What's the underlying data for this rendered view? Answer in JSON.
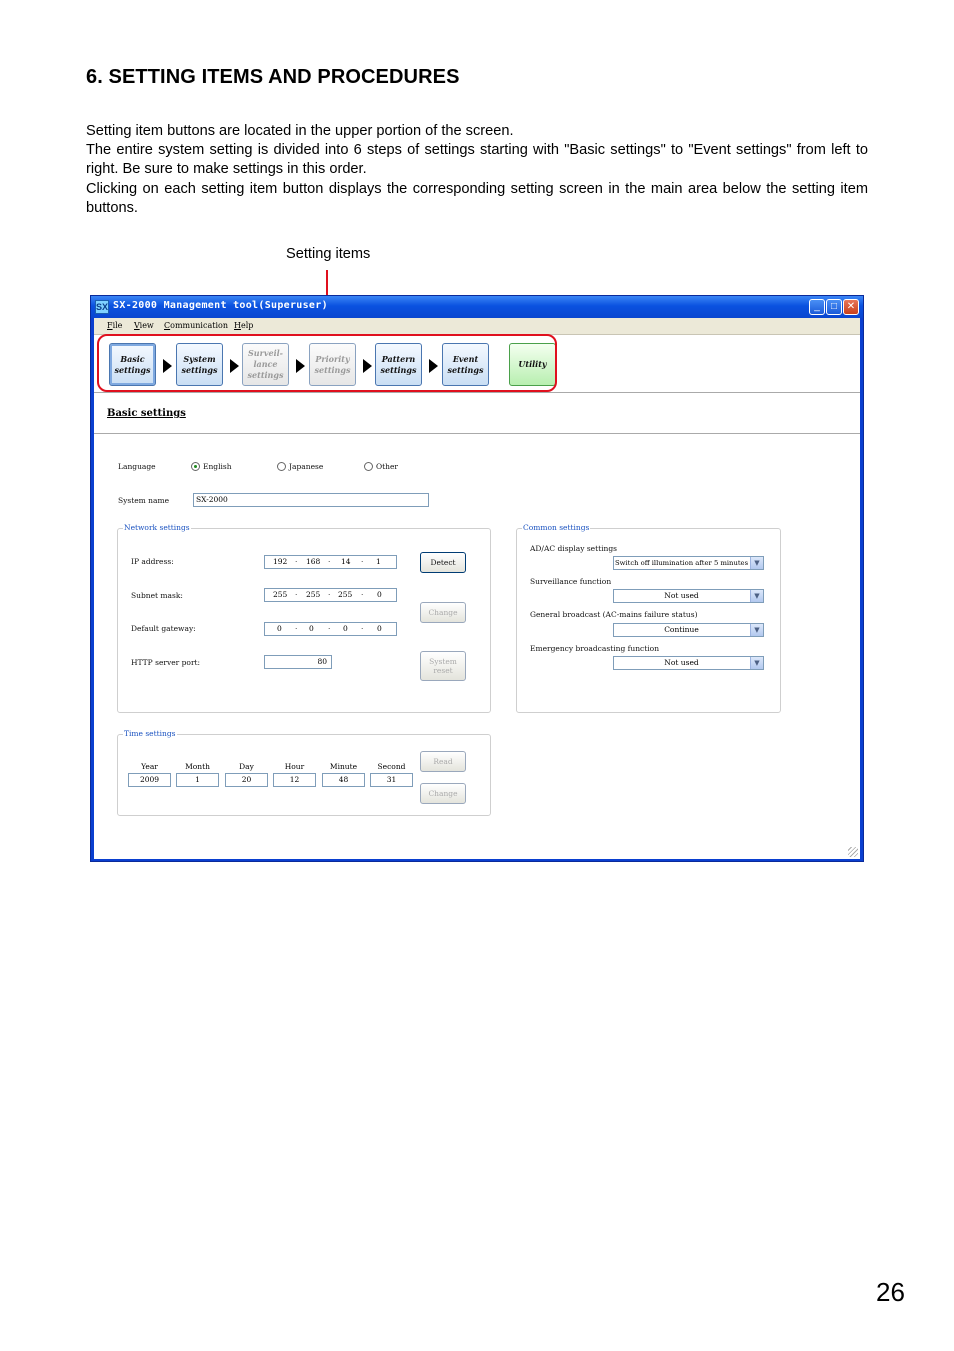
{
  "heading": "6. SETTING ITEMS AND PROCEDURES",
  "paragraphs": [
    "Setting item buttons are located in the upper portion of the screen.",
    "The entire system setting is divided into 6 steps of settings starting with \"Basic settings\" to \"Event settings\" from left to right. Be sure to make settings in this order.",
    "Clicking on each setting item button displays the corresponding setting screen in the main area below the setting item buttons."
  ],
  "callout": "Setting items",
  "window": {
    "title": "SX-2000 Management tool(Superuser)",
    "app_icon": "SX",
    "controls": {
      "min": "_",
      "max": "□",
      "close": "✕"
    },
    "menu": [
      "File",
      "View",
      "Communication",
      "Help"
    ],
    "steps": [
      {
        "l1": "Basic",
        "l2": "settings",
        "l3": ""
      },
      {
        "l1": "System",
        "l2": "settings",
        "l3": ""
      },
      {
        "l1": "Surveil-",
        "l2": "lance",
        "l3": "settings"
      },
      {
        "l1": "Priority",
        "l2": "settings",
        "l3": ""
      },
      {
        "l1": "Pattern",
        "l2": "settings",
        "l3": ""
      },
      {
        "l1": "Event",
        "l2": "settings",
        "l3": ""
      }
    ],
    "utility": "Utility",
    "section_title": "Basic settings",
    "language": {
      "label": "Language",
      "options": [
        "English",
        "Japanese",
        "Other"
      ],
      "selected": "English"
    },
    "system_name": {
      "label": "System name",
      "value": "SX-2000"
    },
    "network": {
      "title": "Network settings",
      "ip_label": "IP address:",
      "ip": [
        "192",
        "168",
        "14",
        "1"
      ],
      "mask_label": "Subnet mask:",
      "mask": [
        "255",
        "255",
        "255",
        "0"
      ],
      "gateway_label": "Default gateway:",
      "gateway": [
        "0",
        "0",
        "0",
        "0"
      ],
      "http_label": "HTTP server port:",
      "http_port": "80",
      "detect": "Detect",
      "change": "Change",
      "system_reset_l1": "System",
      "system_reset_l2": "reset"
    },
    "common": {
      "title": "Common settings",
      "items": [
        {
          "label": "AD/AC display settings",
          "value": "Switch off illumination after 5 minutes"
        },
        {
          "label": "Surveillance function",
          "value": "Not used"
        },
        {
          "label": "General broadcast (AC-mains failure status)",
          "value": "Continue"
        },
        {
          "label": "Emergency broadcasting function",
          "value": "Not used"
        }
      ]
    },
    "time": {
      "title": "Time settings",
      "labels": [
        "Year",
        "Month",
        "Day",
        "Hour",
        "Minute",
        "Second"
      ],
      "values": [
        "2009",
        "1",
        "20",
        "12",
        "48",
        "31"
      ],
      "read": "Read",
      "change": "Change"
    }
  },
  "page_number": "26"
}
